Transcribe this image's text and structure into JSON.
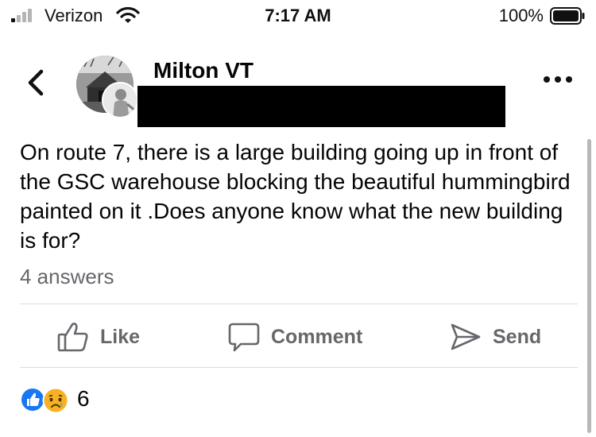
{
  "status_bar": {
    "carrier": "Verizon",
    "time": "7:17 AM",
    "battery_percent": "100%"
  },
  "header": {
    "group_name": "Milton VT",
    "icons": {
      "back": "chevron-left-icon",
      "more": "more-options-icon"
    }
  },
  "post": {
    "text": "On route 7, there is a large building going up in front of the GSC warehouse blocking the beautiful hummingbird painted on it .Does anyone know what the new building is for?",
    "answers_count": "4 answers"
  },
  "actions": [
    {
      "label": "Like",
      "icon": "thumbs-up-icon"
    },
    {
      "label": "Comment",
      "icon": "comment-bubble-icon"
    },
    {
      "label": "Send",
      "icon": "send-icon"
    }
  ],
  "reactions": {
    "types": [
      "like",
      "sad"
    ],
    "count": "6"
  },
  "colors": {
    "accent": "#1877f2",
    "secondary_text": "#65676b",
    "divider": "#dadde1",
    "sad_emoji": "#f7b125"
  }
}
